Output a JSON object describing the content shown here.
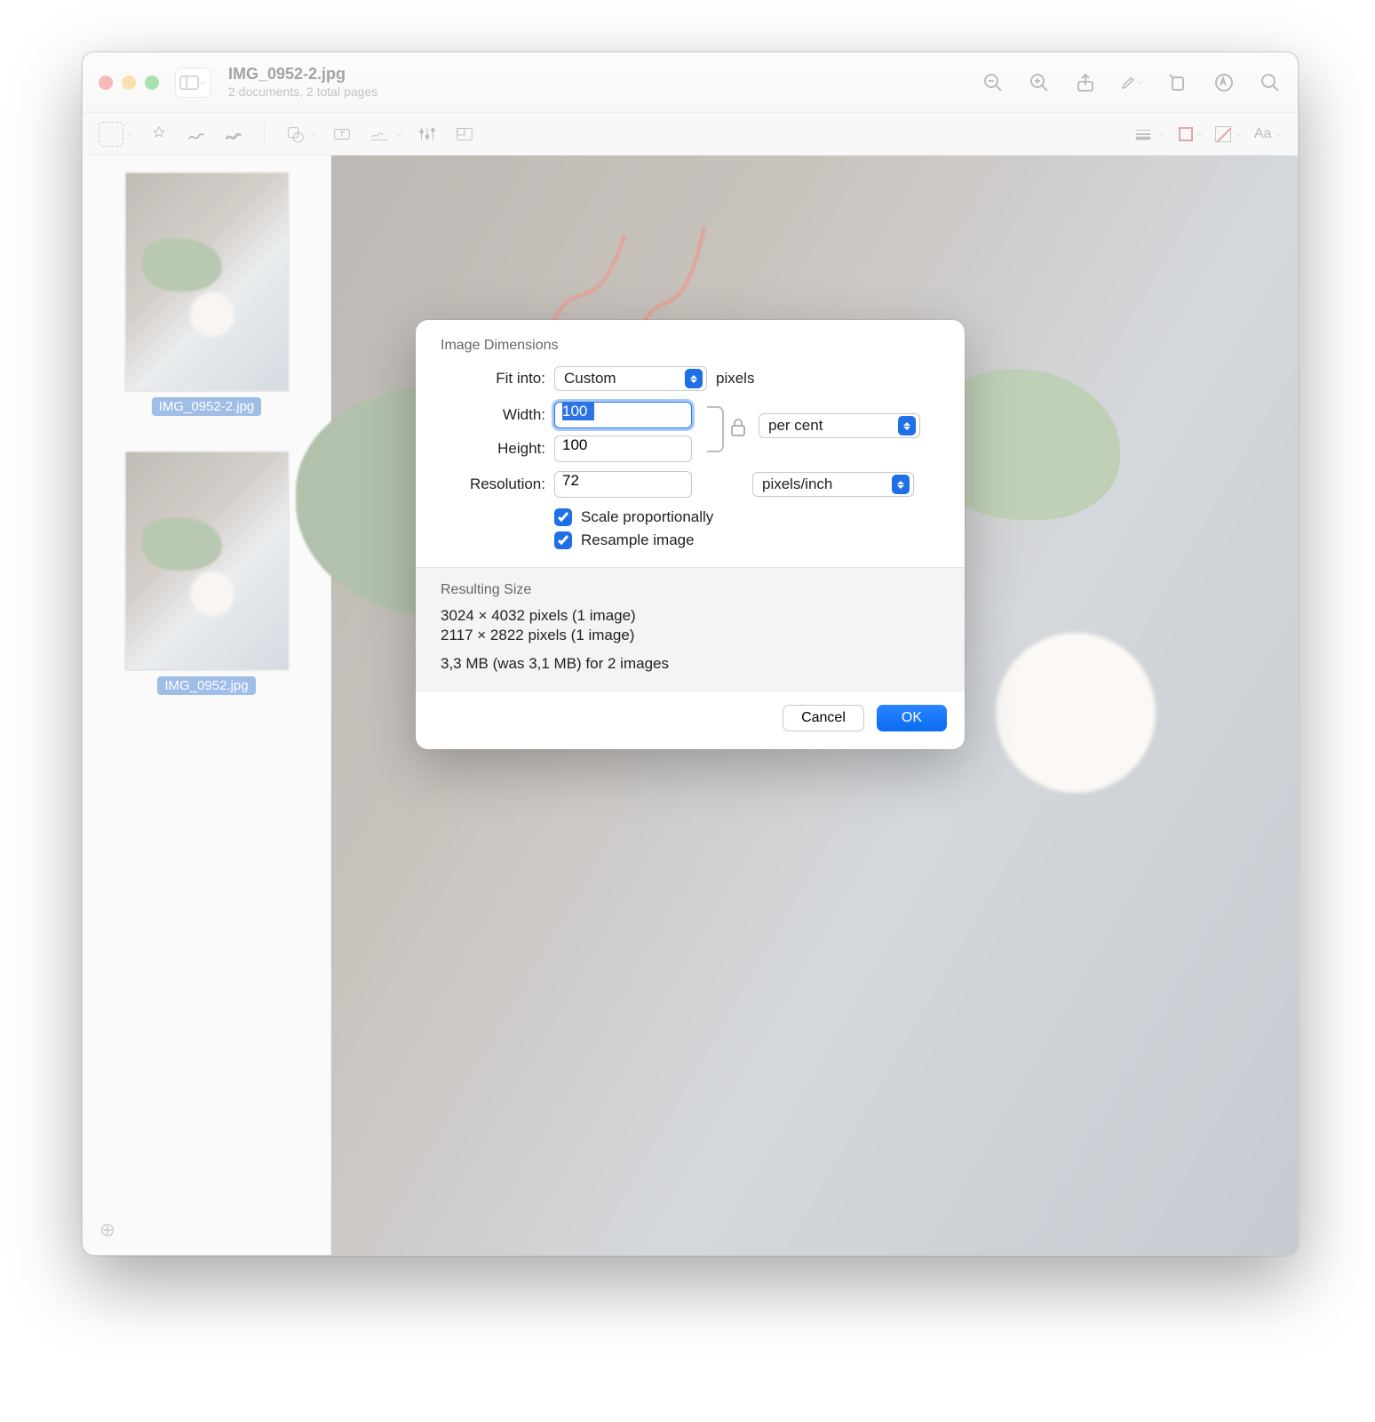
{
  "titlebar": {
    "filename": "IMG_0952-2.jpg",
    "subtitle": "2 documents, 2 total pages"
  },
  "sidebar": {
    "thumbs": [
      {
        "label": "IMG_0952-2.jpg"
      },
      {
        "label": "IMG_0952.jpg"
      }
    ]
  },
  "dialog": {
    "section1_title": "Image Dimensions",
    "fit_into_label": "Fit into:",
    "fit_into_value": "Custom",
    "fit_into_suffix": "pixels",
    "width_label": "Width:",
    "width_value": "100",
    "height_label": "Height:",
    "height_value": "100",
    "wh_unit": "per cent",
    "resolution_label": "Resolution:",
    "resolution_value": "72",
    "resolution_unit": "pixels/inch",
    "scale_prop_label": "Scale proportionally",
    "resample_label": "Resample image",
    "scale_prop_checked": true,
    "resample_checked": true,
    "result_title": "Resulting Size",
    "result_line1": "3024 × 4032 pixels (1 image)",
    "result_line2": "2117 × 2822 pixels (1 image)",
    "result_summary": "3,3 MB (was 3,1 MB) for 2 images",
    "cancel": "Cancel",
    "ok": "OK"
  },
  "secondary_toolbar": {
    "text_style_label": "Aa"
  }
}
